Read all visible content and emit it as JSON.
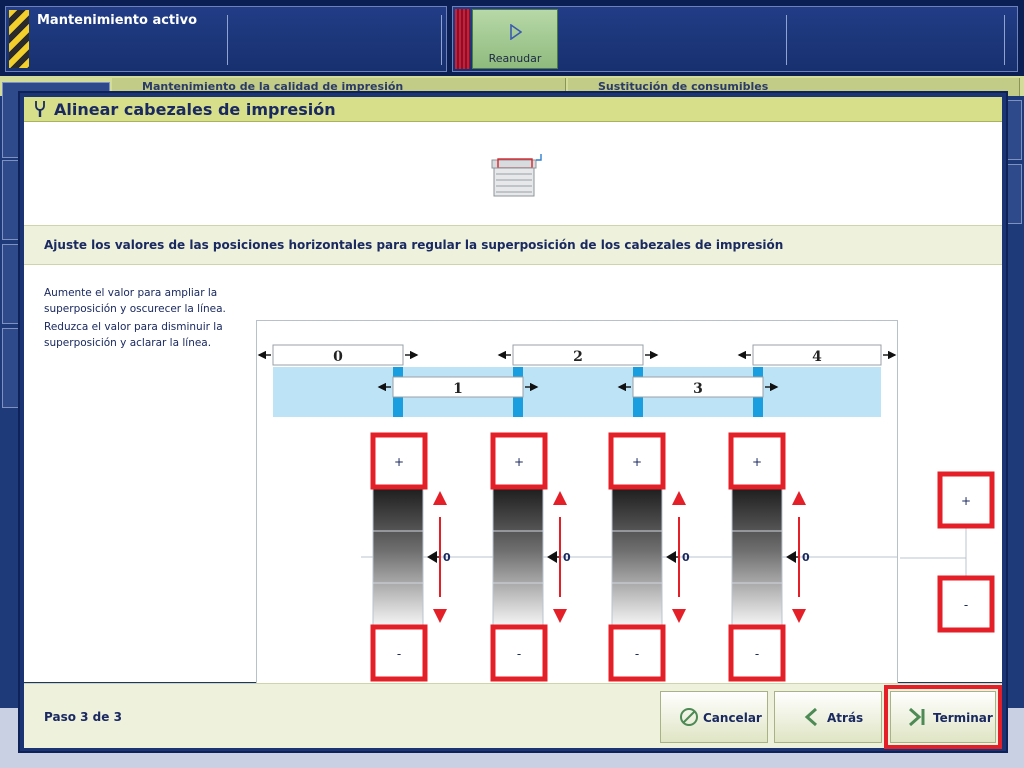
{
  "status_bar": {
    "maintenance_title": "Mantenimiento activo",
    "resume_label": "Reanudar"
  },
  "background": {
    "tab_quality": "Mantenimiento de la calidad de impresión",
    "tab_consumables": "Sustitución de consumibles"
  },
  "dialog": {
    "title": "Alinear cabezales de impresión",
    "instruction": "Ajuste los valores de las posiciones horizontales para regular la superposición de los cabezales de impresión",
    "explanation": [
      "Aumente el valor para ampliar la superposición y oscurecer la línea.",
      "Reduzca el valor para disminuir la superposición y aclarar la línea."
    ],
    "heads_top": [
      "0",
      "2",
      "4"
    ],
    "heads_bottom": [
      "1",
      "3"
    ],
    "gauges": [
      {
        "plus": "+",
        "minus": "-",
        "value": "0"
      },
      {
        "plus": "+",
        "minus": "-",
        "value": "0"
      },
      {
        "plus": "+",
        "minus": "-",
        "value": "0"
      },
      {
        "plus": "+",
        "minus": "-",
        "value": "0"
      }
    ],
    "side_plus": "+",
    "side_minus": "-",
    "step": "Paso 3 de 3",
    "buttons": {
      "cancel": "Cancelar",
      "back": "Atrás",
      "finish": "Terminar"
    }
  },
  "colors": {
    "highlight": "#e41f27",
    "header_accent": "#d7df8a",
    "navy": "#1a2960"
  }
}
